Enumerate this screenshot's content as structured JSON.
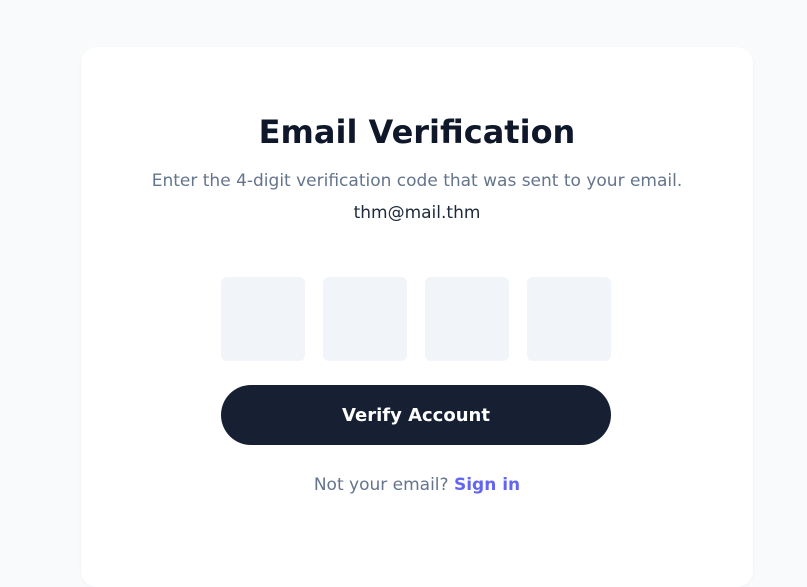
{
  "card": {
    "title": "Email Verification",
    "subtitle": "Enter the 4-digit verification code that was sent to your email.",
    "email": "thm@mail.thm"
  },
  "code_inputs": [
    {
      "value": ""
    },
    {
      "value": ""
    },
    {
      "value": ""
    },
    {
      "value": ""
    }
  ],
  "verify_button": {
    "label": "Verify Account"
  },
  "footer": {
    "prompt": "Not your email?",
    "link_label": "Sign in"
  },
  "colors": {
    "background": "#f8fafc",
    "card": "#ffffff",
    "input_bg": "#f1f5f9",
    "button_bg": "#172033",
    "link": "#6366f1",
    "muted_text": "#64748b",
    "heading": "#0f172a"
  }
}
